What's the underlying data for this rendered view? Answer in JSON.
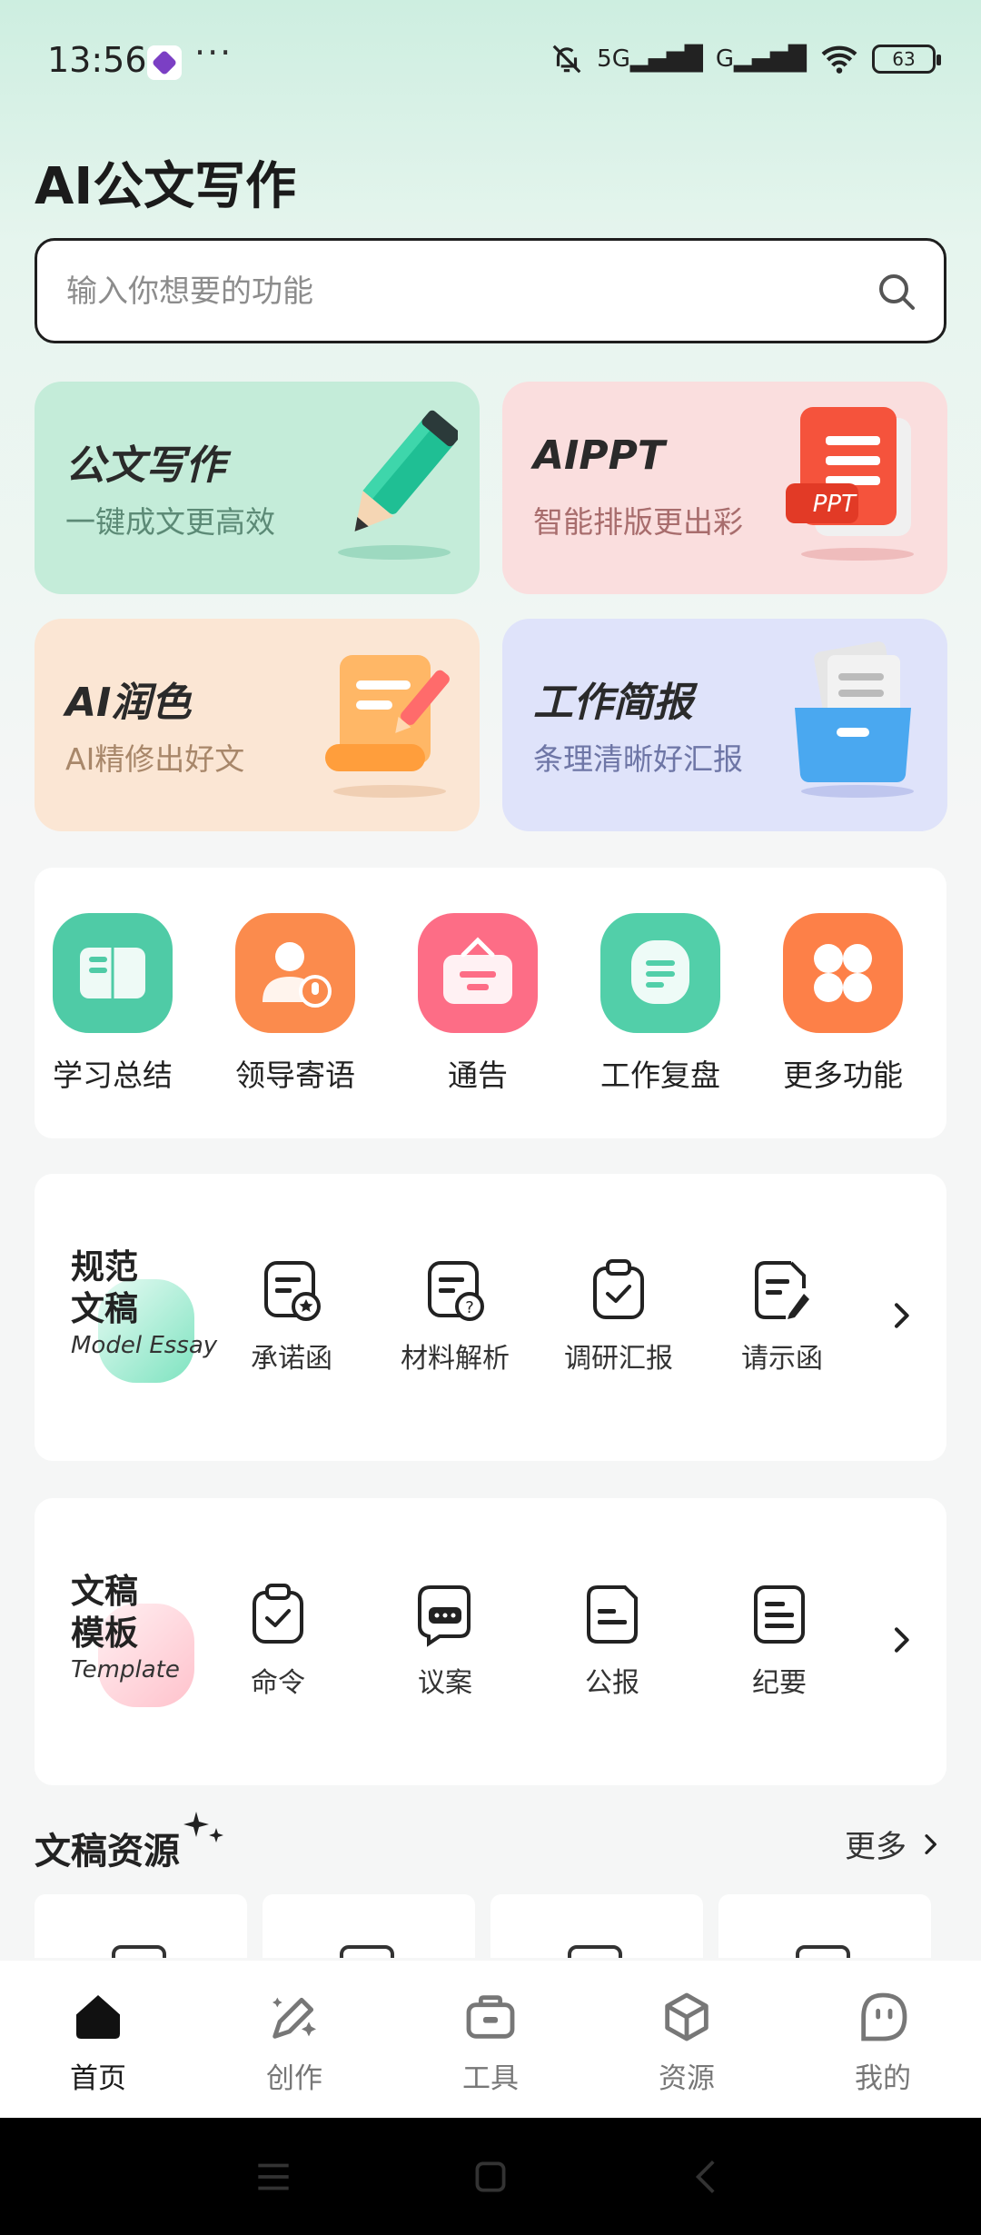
{
  "status_bar": {
    "time": "13:56",
    "dots": "···",
    "signal1": "5G",
    "signal2": "G",
    "battery": "63"
  },
  "page_title": "AI公文写作",
  "search": {
    "placeholder": "输入你想要的功能"
  },
  "feature_cards": [
    {
      "title": "公文写作",
      "subtitle": "一键成文更高效"
    },
    {
      "title": "AIPPT",
      "subtitle": "智能排版更出彩",
      "badge": "PPT"
    },
    {
      "title": "AI润色",
      "subtitle": "AI精修出好文"
    },
    {
      "title": "工作简报",
      "subtitle": "条理清晰好汇报"
    }
  ],
  "quick_tools": [
    {
      "label": "学习总结",
      "icon": "open-book-icon",
      "color": "#4fcba6"
    },
    {
      "label": "领导寄语",
      "icon": "speaker-person-icon",
      "color": "#fb8b4d"
    },
    {
      "label": "通告",
      "icon": "notice-board-icon",
      "color": "#fd6d86"
    },
    {
      "label": "工作复盘",
      "icon": "chat-bubble-icon",
      "color": "#52cfa9"
    },
    {
      "label": "更多功能",
      "icon": "four-petal-icon",
      "color": "#fd8048"
    }
  ],
  "model_essay": {
    "title": "规范\n文稿",
    "title_line1": "规范",
    "title_line2": "文稿",
    "subtitle": "Model Essay",
    "items": [
      {
        "label": "承诺函",
        "icon": "pledge-letter-icon"
      },
      {
        "label": "材料解析",
        "icon": "material-analysis-icon"
      },
      {
        "label": "调研汇报",
        "icon": "clipboard-check-icon"
      },
      {
        "label": "请示函",
        "icon": "request-letter-icon"
      }
    ]
  },
  "template": {
    "title_line1": "文稿",
    "title_line2": "模板",
    "subtitle": "Template",
    "items": [
      {
        "label": "命令",
        "icon": "clipboard-check-icon"
      },
      {
        "label": "议案",
        "icon": "chat-doc-icon"
      },
      {
        "label": "公报",
        "icon": "document-icon"
      },
      {
        "label": "纪要",
        "icon": "note-icon"
      }
    ]
  },
  "resources": {
    "title": "文稿资源",
    "more": "更多"
  },
  "bottom_nav": [
    {
      "label": "首页",
      "icon": "home-icon",
      "active": true
    },
    {
      "label": "创作",
      "icon": "pen-sparkle-icon",
      "active": false
    },
    {
      "label": "工具",
      "icon": "toolbox-icon",
      "active": false
    },
    {
      "label": "资源",
      "icon": "cube-icon",
      "active": false
    },
    {
      "label": "我的",
      "icon": "face-icon",
      "active": false
    }
  ],
  "colors": {
    "accent_green": "#4fcba6",
    "active_nav": "#1b1b1b",
    "inactive_nav": "#777777"
  }
}
